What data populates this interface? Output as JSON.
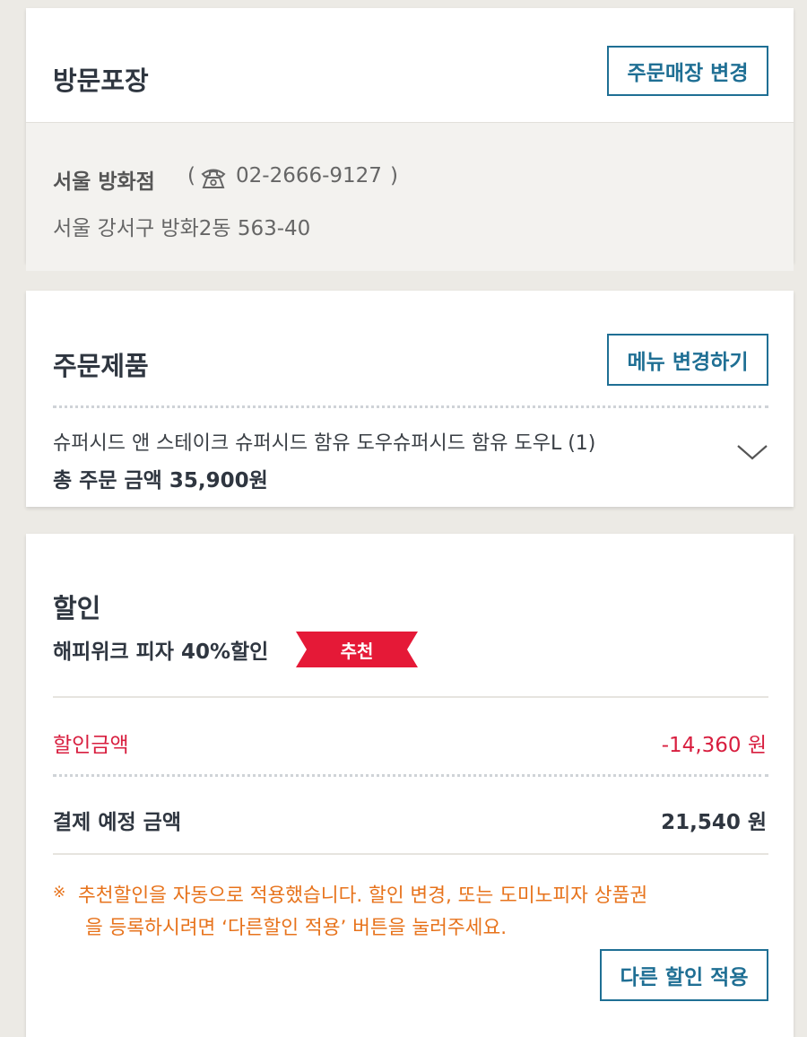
{
  "pickup": {
    "title": "방문포장",
    "change_store_button": "주문매장 변경",
    "store_name": "서울 방화점",
    "phone_open": "(",
    "phone": "02-2666-9127",
    "phone_close": ")",
    "address": "서울 강서구 방화2동 563-40"
  },
  "order": {
    "title": "주문제품",
    "change_menu_button": "메뉴 변경하기",
    "product": "슈퍼시드 앤 스테이크 슈퍼시드 함유 도우슈퍼시드 함유 도우L (1)",
    "total": "총 주문 금액 35,900원"
  },
  "discount": {
    "title": "할인",
    "promo_name": "해피위크 피자 40%할인",
    "promo_badge": "추천",
    "discount_label": "할인금액",
    "discount_value": "-14,360 원",
    "payment_label": "결제 예정 금액",
    "payment_value": "21,540 원",
    "notice_mark": "※",
    "notice_line1": "추천할인을 자동으로 적용했습니다. 할인 변경, 또는 도미노피자 상품권",
    "notice_line2": "을 등록하시려면 ‘다른할인 적용’ 버튼을 눌러주세요.",
    "other_discount_button": "다른 할인 적용"
  },
  "colors": {
    "accent_blue": "#1f6f94",
    "discount_red": "#d81e3f",
    "notice_orange": "#e7731c",
    "badge_red": "#e51937"
  }
}
